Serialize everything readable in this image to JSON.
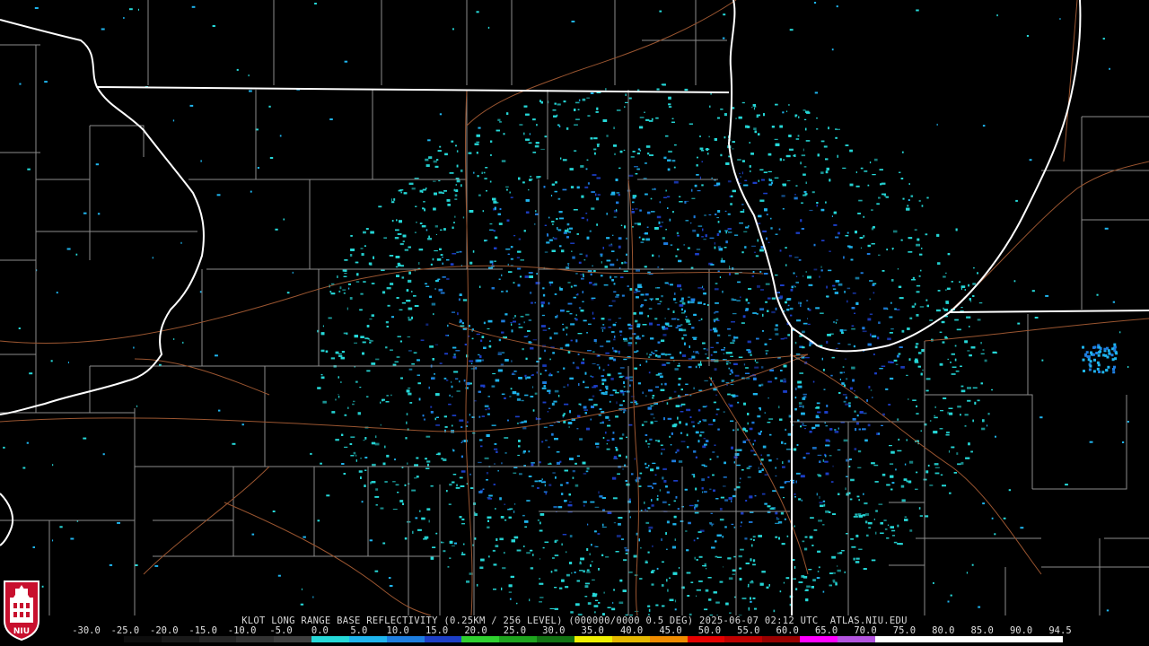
{
  "caption": "KLOT LONG RANGE BASE REFLECTIVITY (0.25KM / 256 LEVEL) (000000/0000 0.5 DEG) 2025-06-07 02:12 UTC  ATLAS.NIU.EDU",
  "logo_text": "NIU",
  "colorbar": {
    "labels": [
      "-30.0",
      "-25.0",
      "-20.0",
      "-15.0",
      "-10.0",
      "-5.0",
      "0.0",
      "5.0",
      "10.0",
      "15.0",
      "20.0",
      "25.0",
      "30.0",
      "35.0",
      "40.0",
      "45.0",
      "50.0",
      "55.0",
      "60.0",
      "65.0",
      "70.0",
      "75.0",
      "80.0",
      "85.0",
      "90.0",
      "94.5"
    ],
    "colors": [
      "#000000",
      "#0d0d0d",
      "#1a1a1a",
      "#262626",
      "#333333",
      "#404040",
      "#26d9d9",
      "#1fb5ee",
      "#1e7ee0",
      "#1d3fc8",
      "#2fd12f",
      "#1ea41e",
      "#137313",
      "#f0f000",
      "#e6b800",
      "#f08c00",
      "#e60000",
      "#bf0000",
      "#990000",
      "#ff00ff",
      "#b455e0",
      "#ffffff",
      "#ffffff",
      "#ffffff",
      "#ffffff",
      "#ffffff"
    ]
  },
  "radar": {
    "site": "KLOT",
    "product": "Base Reflectivity",
    "tilt_deg": 0.5
  }
}
